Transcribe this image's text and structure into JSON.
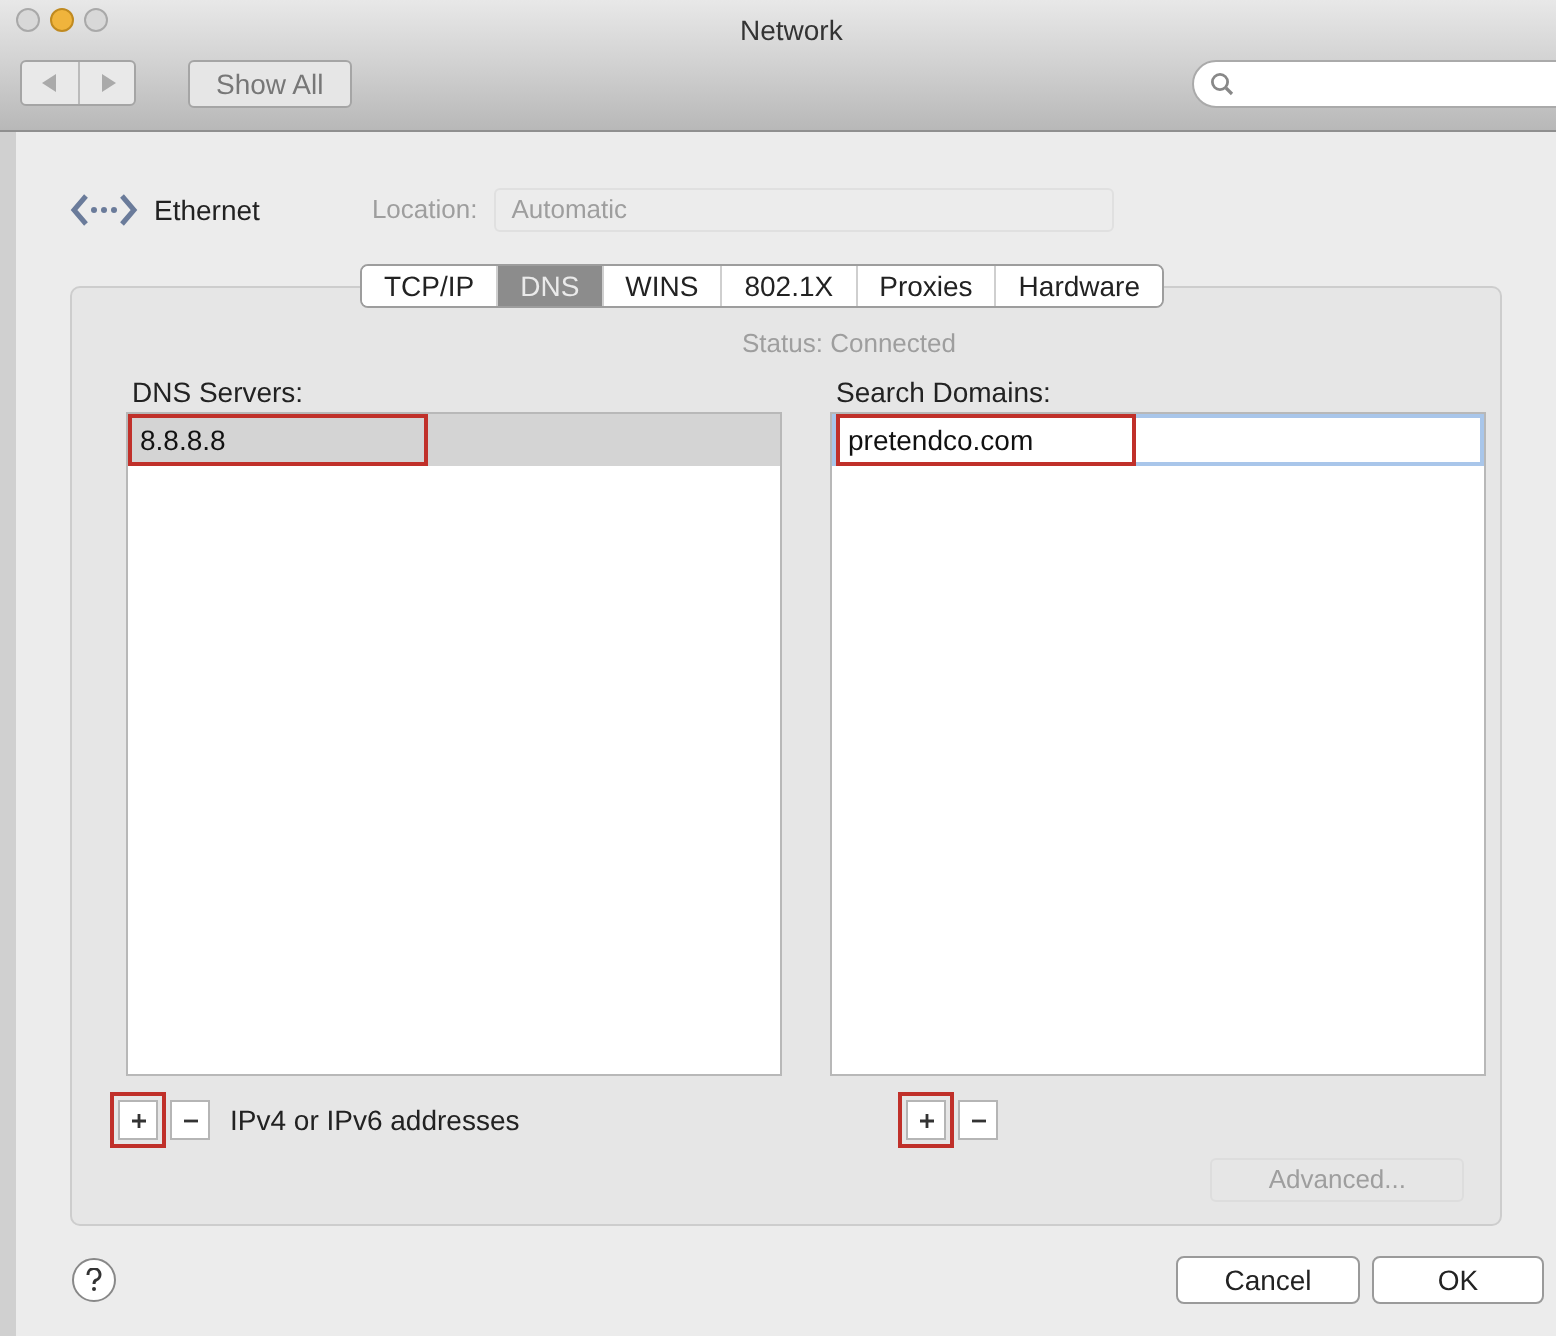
{
  "window": {
    "title": "Network"
  },
  "toolbar": {
    "show_all": "Show All"
  },
  "header": {
    "service": "Ethernet",
    "location_label": "Location:",
    "location_value": "Automatic"
  },
  "background": {
    "status_label": "Status:",
    "status_value": "Connected",
    "advanced": "Advanced..."
  },
  "tabs": [
    {
      "label": "TCP/IP",
      "selected": false
    },
    {
      "label": "DNS",
      "selected": true
    },
    {
      "label": "WINS",
      "selected": false
    },
    {
      "label": "802.1X",
      "selected": false
    },
    {
      "label": "Proxies",
      "selected": false
    },
    {
      "label": "Hardware",
      "selected": false
    }
  ],
  "dns_servers": {
    "label": "DNS Servers:",
    "entries": [
      {
        "text": "8.8.8.8",
        "selected": true,
        "editing": false,
        "highlighted": true
      }
    ],
    "add_highlighted": true,
    "hint": "IPv4 or IPv6 addresses"
  },
  "search_domains": {
    "label": "Search Domains:",
    "entries": [
      {
        "text": "pretendco.com",
        "selected": false,
        "editing": true,
        "highlighted": true
      }
    ],
    "add_highlighted": true
  },
  "buttons": {
    "cancel": "Cancel",
    "ok": "OK"
  }
}
